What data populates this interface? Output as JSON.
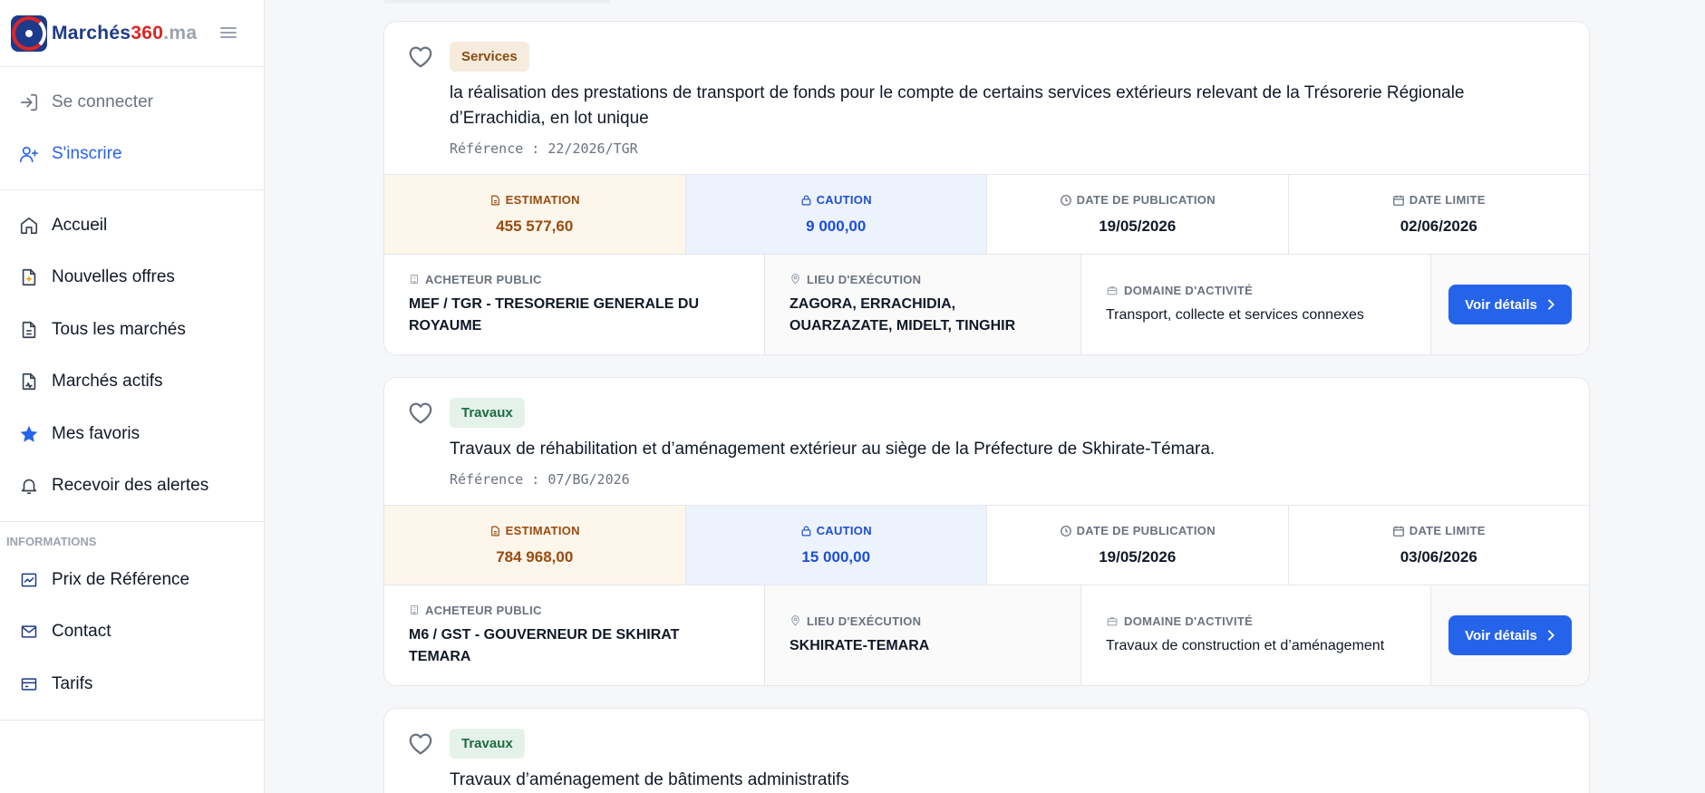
{
  "brand": {
    "part1": "Marchés",
    "part2": "360",
    "part3": ".ma"
  },
  "sidebar": {
    "auth": [
      {
        "label": "Se connecter",
        "icon": "login-icon"
      },
      {
        "label": "S'inscrire",
        "icon": "user-plus-icon"
      }
    ],
    "main": [
      {
        "label": "Accueil",
        "icon": "home-icon"
      },
      {
        "label": "Nouvelles offres",
        "icon": "file-new-icon"
      },
      {
        "label": "Tous les marchés",
        "icon": "file-text-icon"
      },
      {
        "label": "Marchés actifs",
        "icon": "file-active-icon"
      },
      {
        "label": "Mes favoris",
        "icon": "star-icon"
      },
      {
        "label": "Recevoir des alertes",
        "icon": "bell-icon"
      }
    ],
    "info_heading": "INFORMATIONS",
    "info": [
      {
        "label": "Prix de Référence",
        "icon": "chart-icon"
      },
      {
        "label": "Contact",
        "icon": "mail-icon"
      },
      {
        "label": "Tarifs",
        "icon": "credit-card-icon"
      }
    ]
  },
  "labels": {
    "estimation": "ESTIMATION",
    "caution": "CAUTION",
    "publication": "DATE DE PUBLICATION",
    "limite": "DATE LIMITE",
    "acheteur": "ACHETEUR PUBLIC",
    "lieu": "LIEU D'EXÉCUTION",
    "domaine": "DOMAINE D'ACTIVITÉ",
    "details": "Voir détails"
  },
  "cards": [
    {
      "category": "Services",
      "title": "la réalisation des prestations de transport de fonds pour le compte de certains services extérieurs relevant de la Trésorerie Régionale d’Errachidia, en lot unique",
      "reference": "Référence : 22/2026/TGR",
      "estimation": "455 577,60",
      "caution": "9 000,00",
      "date_publication": "19/05/2026",
      "date_limite": "02/06/2026",
      "acheteur": "MEF / TGR - TRESORERIE GENERALE DU ROYAUME",
      "lieu": "ZAGORA, ERRACHIDIA, OUARZAZATE, MIDELT, TINGHIR",
      "domaine": "Transport, collecte et services connexes"
    },
    {
      "category": "Travaux",
      "title": "Travaux de réhabilitation et d’aménagement extérieur au siège de la Préfecture de Skhirate-Témara.",
      "reference": "Référence : 07/BG/2026",
      "estimation": "784 968,00",
      "caution": "15 000,00",
      "date_publication": "19/05/2026",
      "date_limite": "03/06/2026",
      "acheteur": "M6 / GST - GOUVERNEUR DE SKHIRAT TEMARA",
      "lieu": "SKHIRATE-TEMARA",
      "domaine": "Travaux de construction et d’aménagement"
    },
    {
      "category": "Travaux",
      "title": "Travaux d’aménagement de bâtiments administratifs"
    }
  ]
}
